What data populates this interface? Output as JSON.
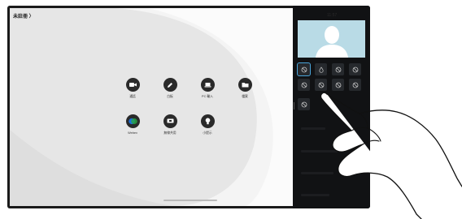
{
  "breadcrumb": {
    "text": "未註冊 〉"
  },
  "apps": [
    {
      "label": "通話",
      "icon": "video-camera-icon"
    },
    {
      "label": "白板",
      "icon": "pencil-icon"
    },
    {
      "label": "PC 輸入",
      "icon": "laptop-icon"
    },
    {
      "label": "檔案",
      "icon": "folder-icon"
    },
    {
      "label": "Webex",
      "icon": "webex-icon"
    },
    {
      "label": "無線共用",
      "icon": "screen-share-icon"
    },
    {
      "label": "小提示",
      "icon": "lightbulb-icon"
    }
  ],
  "panel": {
    "time": "11:57",
    "background_options": [
      {
        "icon": "none-icon",
        "selected": true
      },
      {
        "icon": "blur-drop-icon",
        "selected": false
      },
      {
        "icon": "none-icon",
        "selected": false
      },
      {
        "icon": "none-icon",
        "selected": false
      },
      {
        "icon": "none-icon",
        "selected": false
      },
      {
        "icon": "none-icon",
        "selected": false
      },
      {
        "icon": "none-icon",
        "selected": false
      },
      {
        "icon": "none-icon",
        "selected": false
      },
      {
        "icon": "none-icon",
        "selected": false
      }
    ]
  },
  "colors": {
    "device_bezel": "#1a1a1a",
    "screen_bg": "#e6e6e6",
    "panel_bg": "#111214",
    "preview_bg": "#b9dbe6",
    "accent": "#4aa3d8",
    "webex_blue": "#1e6fd9"
  }
}
